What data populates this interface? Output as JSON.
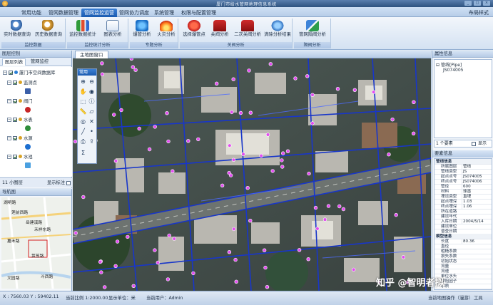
{
  "window": {
    "title": "厦门市给水管网地理信息系统",
    "buttons": [
      "_",
      "□",
      "×"
    ]
  },
  "ribbon_tabs": [
    "常用功能",
    "管网数据管理",
    "管网监控运营",
    "管网协力调度",
    "系统管理",
    "权限与配置管理"
  ],
  "ribbon_active_tab": "管网监控运营",
  "layout_label": "布局样式",
  "ribbon_groups": [
    {
      "label": "监控数据",
      "buttons": [
        "实时数据查询",
        "历史数据查询"
      ]
    },
    {
      "label": "监控统计分析",
      "buttons": [
        "监控数据统计",
        "图表分析"
      ]
    },
    {
      "label": "专题分析",
      "buttons": [
        "爆管分析",
        "火灾分析"
      ]
    },
    {
      "label": "关阀分析",
      "buttons": [
        "选择爆管点",
        "关阀分析",
        "二次关阀分析",
        "清除分析结果"
      ]
    },
    {
      "label": "隔阀分析",
      "buttons": [
        "管网隔阀分析"
      ]
    }
  ],
  "layer_panel": {
    "title": "图层控制",
    "tabs": [
      "图层列表",
      "管网监控"
    ],
    "tree": [
      {
        "label": "厦门市空间数据库",
        "level": 0
      },
      {
        "label": "监测点",
        "level": 1
      },
      {
        "label": "阀门",
        "level": 1
      },
      {
        "label": "水表",
        "level": 1
      },
      {
        "label": "水源",
        "level": 1
      },
      {
        "label": "水池",
        "level": 1
      }
    ],
    "scale_label": "11 小图层",
    "show_label": "显示标注"
  },
  "nav_panel": {
    "title": "导航图",
    "labels": [
      "湖明路",
      "莲前西路",
      "岳建溪路",
      "禾祥东路",
      "嘉禾路",
      "文园路",
      "斗西路",
      "筼筜路"
    ]
  },
  "main_map": {
    "tab": "主地图窗口"
  },
  "toolbox": {
    "title": "常用",
    "tools": [
      "zoom-in",
      "zoom-out",
      "pan",
      "full-extent",
      "select",
      "identify",
      "measure-distance",
      "measure-area",
      "buffer",
      "clear",
      "draw-line",
      "draw-point",
      "print",
      "export",
      "sum",
      ""
    ]
  },
  "attribute_panel": {
    "title": "属性信息",
    "tree_root": "管线[Pipe]",
    "tree_child": "JS074005",
    "count_label": "1 个要素",
    "show_label": "显示",
    "table_title": "要素信息",
    "rows": [
      {
        "section": "管线信息"
      },
      {
        "k": "所属图层",
        "v": "管线"
      },
      {
        "k": "管线类型",
        "v": "JS"
      },
      {
        "k": "起点点号",
        "v": "JS074005"
      },
      {
        "k": "终点点号",
        "v": "JS074006"
      },
      {
        "k": "管径",
        "v": "600"
      },
      {
        "k": "材料",
        "v": "球墨"
      },
      {
        "k": "埋设类型",
        "v": "直埋"
      },
      {
        "k": "起点埋深",
        "v": "1.03"
      },
      {
        "k": "终点埋深",
        "v": "1.06"
      },
      {
        "k": "所在道路",
        "v": ""
      },
      {
        "k": "建设年代",
        "v": ""
      },
      {
        "k": "入库日期",
        "v": "2004/5/14"
      },
      {
        "k": "建设单位",
        "v": ""
      },
      {
        "k": "普查日期",
        "v": ""
      },
      {
        "section": "模型信息"
      },
      {
        "k": "长度",
        "v": "80.36"
      },
      {
        "k": "直径",
        "v": ""
      },
      {
        "k": "粗糙系数",
        "v": ""
      },
      {
        "k": "损失系数",
        "v": ""
      },
      {
        "k": "初始状态",
        "v": ""
      },
      {
        "k": "流量",
        "v": ""
      },
      {
        "k": "流速",
        "v": ""
      },
      {
        "k": "单位水头",
        "v": ""
      },
      {
        "k": "摩阻因子",
        "v": ""
      },
      {
        "k": "水质",
        "v": ""
      }
    ]
  },
  "status_bar": {
    "coords": "X : 7560.03  Y : 59402.11",
    "scale": "当前比例 1:2000.00",
    "unit": "显示单位：米",
    "user": "当前用户：Admin",
    "tool": "当前地图操作（漫游）",
    "tool_right": "工具"
  },
  "watermark": "知乎 @智明者拟"
}
